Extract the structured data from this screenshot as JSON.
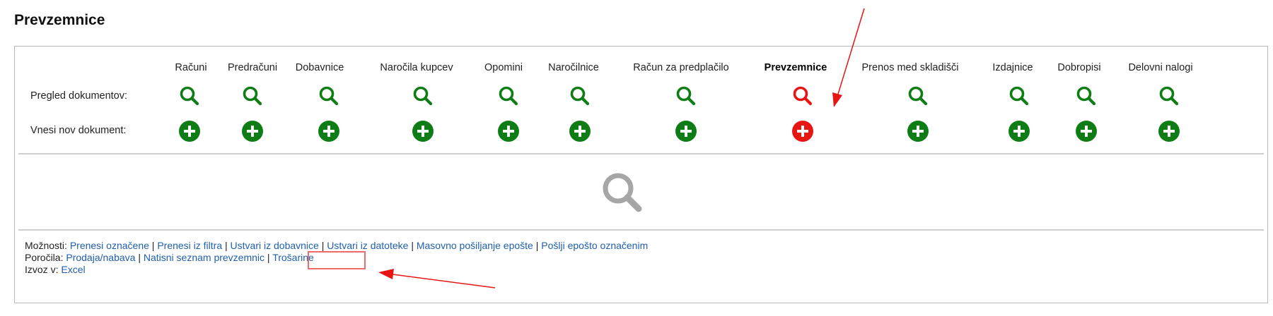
{
  "page": {
    "title": "Prevzemnice"
  },
  "columns": [
    {
      "label": "Računi",
      "active": false
    },
    {
      "label": "Predračuni",
      "active": false
    },
    {
      "label": "Dobavnice",
      "active": false
    },
    {
      "label": "Naročila kupcev",
      "active": false
    },
    {
      "label": "Opomini",
      "active": false
    },
    {
      "label": "Naročilnice",
      "active": false
    },
    {
      "label": "Račun za predplačilo",
      "active": false
    },
    {
      "label": "Prevzemnice",
      "active": true
    },
    {
      "label": "Prenos med skladišči",
      "active": false
    },
    {
      "label": "Izdajnice",
      "active": false
    },
    {
      "label": "Dobropisi",
      "active": false
    },
    {
      "label": "Delovni nalogi",
      "active": false
    }
  ],
  "rows": {
    "view_label": "Pregled dokumentov:",
    "new_label": "Vnesi nov dokument:"
  },
  "icons": {
    "view": "search-icon",
    "new": "plus-circle-icon",
    "empty_state": "search-icon"
  },
  "colors": {
    "inactive": "#0f7d16",
    "active": "#e81515",
    "link": "#1f5fae",
    "empty_icon": "#a6a6a6",
    "annotation": "#e81515"
  },
  "options": {
    "label": "Možnosti:",
    "links": [
      "Prenesi označene",
      "Prenesi iz filtra",
      "Ustvari iz dobavnice",
      "Ustvari iz datoteke",
      "Masovno pošiljanje epošte",
      "Pošlji epošto označenim"
    ]
  },
  "reports": {
    "label": "Poročila:",
    "links": [
      "Prodaja/nabava",
      "Natisni seznam prevzemnic",
      "Trošarine"
    ]
  },
  "export": {
    "label": "Izvoz v:",
    "links": [
      "Excel"
    ]
  },
  "separator": "|"
}
